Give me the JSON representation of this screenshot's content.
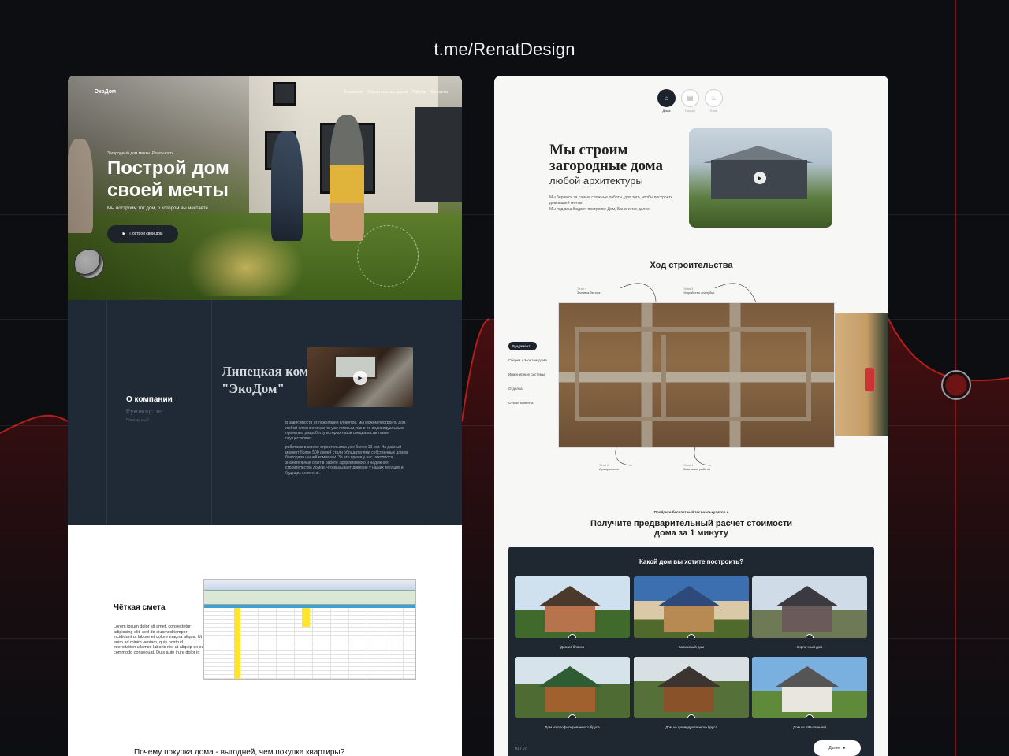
{
  "watermark": "t.me/RenatDesign",
  "left": {
    "hero": {
      "logo": "ЭкоДом",
      "menu": [
        "Фазисы-эт",
        "Строительство домов",
        "Работы",
        "Контакты"
      ],
      "kicker": "Загородный дом мечты. Реальность",
      "title": "Построй дом своей мечты",
      "subtitle": "Мы построим тот дом, о котором вы мечтаете",
      "button": "Построй свой дом"
    },
    "about": {
      "nav_active": "О компании",
      "nav_items": [
        "Руководство",
        "Почему мы?"
      ],
      "title": "Липецкая компания \"ЭкоДом\"",
      "p1": "В зависимости от пожеланий клиентов, мы можем построить дом любой сложности как по уже готовым, так и по индивидуальным проектам, разработку которых наши специалисты также осуществляют.",
      "p2": "работаем в сфере строительства уже более 13 лет. На данный момент более 500 семей стали обладателями собственных домов благодаря нашей компании. За это время у нас накопился значительный опыт в работе эффективного и надежного строительства домов, что вызывает доверие у наших текущих и будущих клиентов."
    },
    "estimate": {
      "title": "Чёткая смета",
      "desc": "Lorem ipsum dolor sit amet, consectetur adipiscing elit, sed do eiusmod tempor incididunt ut labore et dolore magna aliqua. Ut enim ad minim veniam, quis nostrud exercitation ullamco laboris nisi ut aliquip ex ea commodo consequat. Duis aute irure dolor in",
      "bottom_question": "Почему покупка дома - выгодней, чем покупка квартиры?"
    }
  },
  "right": {
    "tabs": [
      {
        "label": "Дома",
        "icon": "house-icon"
      },
      {
        "label": "Гаражи",
        "icon": "garage-icon"
      },
      {
        "label": "Бани",
        "icon": "sauna-icon"
      }
    ],
    "intro": {
      "title": "Мы строим загородные дома",
      "subtitle": "любой архитектуры",
      "text1": "Мы беремся за самые сложные работы, для того, чтобы построить дом вашей мечты",
      "text2": "Мы под ваш бюджет построим: Дом, Баню и так далее"
    },
    "progress": {
      "title": "Ход строительства",
      "steps": [
        "Фундамент",
        "Сборка и Монтаж дома",
        "Инженерные системы",
        "Отделка",
        "Отмая клиента"
      ],
      "callouts": [
        {
          "n": "Этап 4",
          "label": "Заливка бетона"
        },
        {
          "n": "Этап 3",
          "label": "Устройство опалубки"
        },
        {
          "n": "Этап 2",
          "label": "Армирование"
        },
        {
          "n": "Этап 1",
          "label": "Земляные работы"
        }
      ]
    },
    "calc": {
      "kicker": "Пройдите бесплатный тест-калькулятор и",
      "title": "Получите предварительный расчет стоимости дома за 1 минуту"
    },
    "quiz": {
      "question": "Какой дом вы хотите построить?",
      "options": [
        "Дом из блоков",
        "Каркасный дом",
        "Кирпичный дом",
        "Дом из профилированного бруса",
        "Дом из цилиндрованного бруса",
        "Дом из SIP-панелей"
      ],
      "counter": "01 / 07",
      "next": "Далее"
    }
  },
  "colors": {
    "dark_navy": "#1f2a36",
    "quiz_bg": "#1f2731",
    "accent_red": "#b51c1c"
  }
}
